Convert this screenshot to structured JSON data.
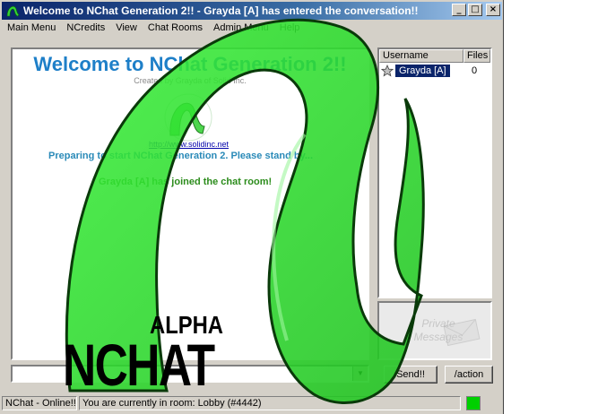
{
  "window": {
    "title": "Welcome to NChat Generation 2!! - Grayda [A] has entered the conversation!!",
    "min_label": "_",
    "max_label": "□",
    "close_label": "×"
  },
  "menu": {
    "items": [
      "Main Menu",
      "NCredits",
      "View",
      "Chat Rooms",
      "Admin Menu",
      "Help"
    ]
  },
  "chat": {
    "welcome": "Welcome to NChat Generation 2!!",
    "created_by": "Created by Grayda of Solid Inc.",
    "url": "http://www.solidinc.net",
    "preparing": "Preparing to start NChat Generation 2. Please stand by...",
    "joined": "Grayda [A]  has joined the chat room!"
  },
  "userlist": {
    "columns": [
      "Username",
      "Files"
    ],
    "users": [
      {
        "name": "Grayda [A]",
        "files": "0"
      }
    ]
  },
  "private_messages": {
    "label_line1": "Private",
    "label_line2": "Messages"
  },
  "input": {
    "value": ""
  },
  "buttons": {
    "send": "Send!!",
    "action": "/action"
  },
  "status": {
    "connection": "NChat - Online!!",
    "room": "You are currently in room: Lobby (#4442)",
    "led_color": "#00d000"
  },
  "splash": {
    "alpha": "ALPHA",
    "product": "NCHAT",
    "logo_color": "#2ee82e"
  }
}
